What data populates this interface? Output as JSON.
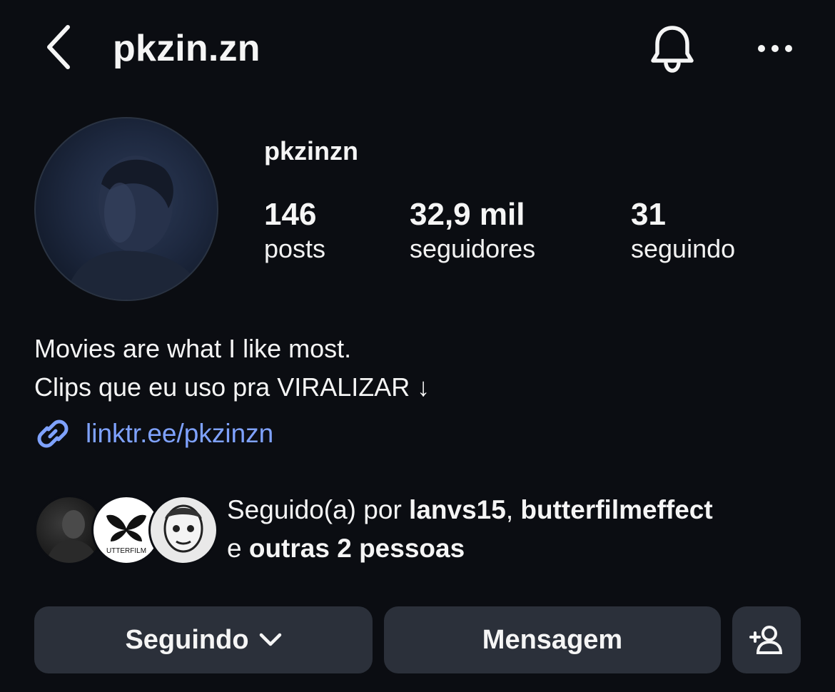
{
  "header": {
    "title": "pkzin.zn",
    "back_icon": "chevron-left-icon",
    "notifications_icon": "bell-icon",
    "more_icon": "ellipsis-icon"
  },
  "profile": {
    "name": "pkzinzn",
    "stats": [
      {
        "value": "146",
        "label": "posts"
      },
      {
        "value": "32,9 mil",
        "label": "seguidores"
      },
      {
        "value": "31",
        "label": "seguindo"
      }
    ],
    "bio": {
      "line1": "Movies are what I like most.",
      "line2": "Clips que eu uso pra VIRALIZAR ↓"
    },
    "link": "linktr.ee/pkzinzn"
  },
  "followed_by": {
    "prefix": "Seguido(a) por ",
    "user1": "lanvs15",
    "separator": ", ",
    "user2": "butterfilmeffect",
    "connector": "e ",
    "others": "outras 2 pessoas",
    "avatar_logo_text": "UTTERFILM"
  },
  "actions": {
    "following_label": "Seguindo",
    "message_label": "Mensagem",
    "add_icon": "add-user-icon"
  },
  "colors": {
    "background": "#0b0d12",
    "button": "#2b303a",
    "link": "#7fa2ff"
  }
}
